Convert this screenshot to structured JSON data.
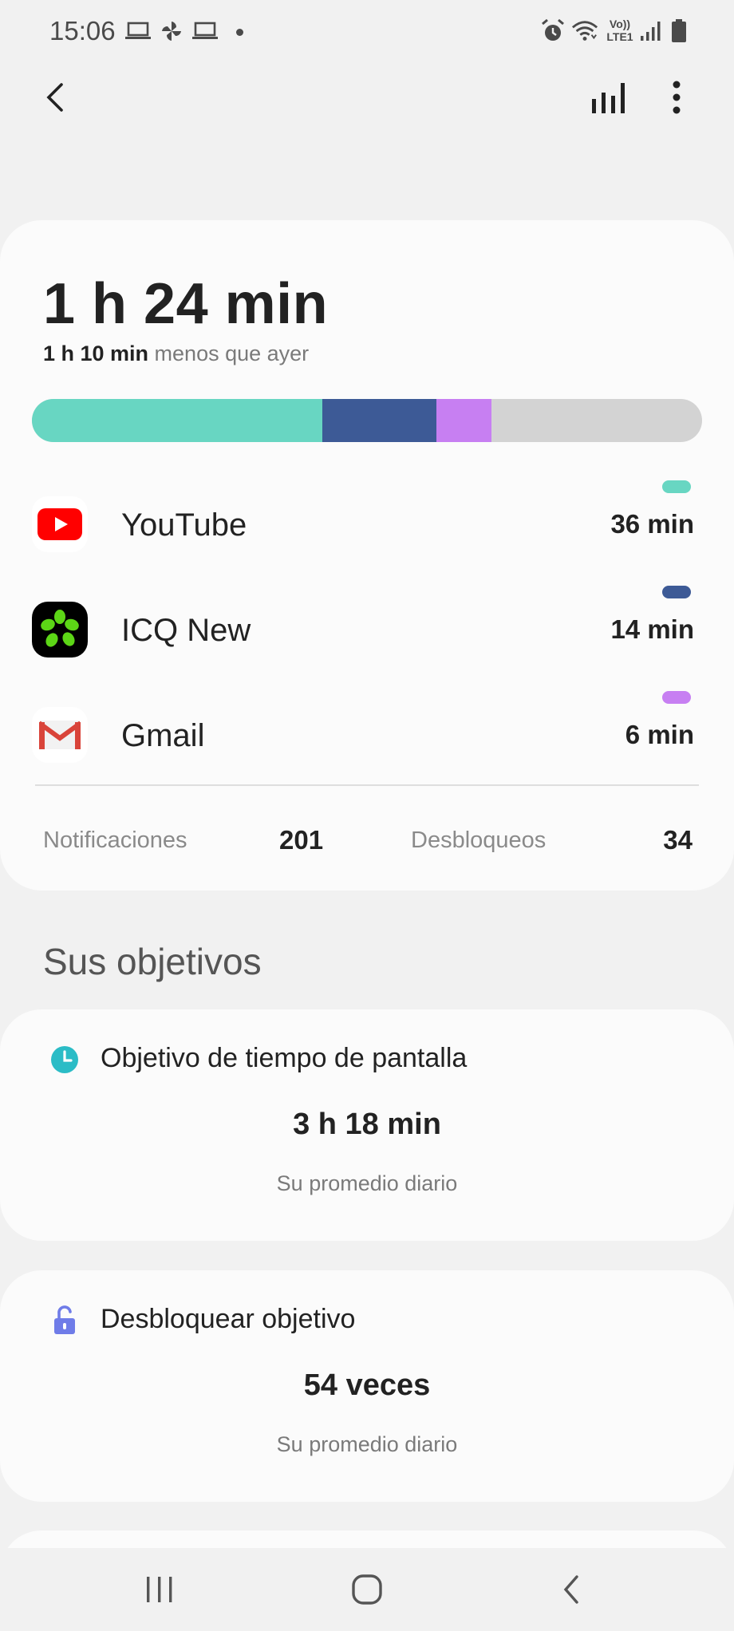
{
  "status_bar": {
    "time": "15:06",
    "right_icons": [
      "alarm-icon",
      "wifi-icon",
      "volte-lte-icon",
      "signal-icon",
      "battery-icon"
    ],
    "volte_label": "Vo))",
    "lte_label": "LTE1"
  },
  "summary": {
    "total_time": "1 h 24 min",
    "compare_bold": "1 h 10 min",
    "compare_rest": " menos que ayer",
    "usage_bar": [
      {
        "app": "YouTube",
        "fraction": 0.433,
        "color": "#68d6c2"
      },
      {
        "app": "ICQ New",
        "fraction": 0.171,
        "color": "#3d5a96"
      },
      {
        "app": "Gmail",
        "fraction": 0.082,
        "color": "#c77ff2"
      }
    ],
    "apps": [
      {
        "name": "YouTube",
        "time": "36 min",
        "color": "#68d6c2",
        "icon": "youtube-icon"
      },
      {
        "name": "ICQ New",
        "time": "14 min",
        "color": "#3d5a96",
        "icon": "icq-icon"
      },
      {
        "name": "Gmail",
        "time": "6 min",
        "color": "#c77ff2",
        "icon": "gmail-icon"
      }
    ],
    "notifications_label": "Notificaciones",
    "notifications_value": "201",
    "unlocks_label": "Desbloqueos",
    "unlocks_value": "34"
  },
  "goals": {
    "section_title": "Sus objetivos",
    "screen_time": {
      "title": "Objetivo de tiempo de pantalla",
      "value": "3 h 18 min",
      "sub": "Su promedio diario"
    },
    "unlock": {
      "title": "Desbloquear objetivo",
      "value": "54 veces",
      "sub": "Su promedio diario"
    }
  },
  "colors": {
    "background": "#f1f1f1",
    "card": "#fbfbfb",
    "clock_icon": "#2bbcc6",
    "lock_icon": "#6f7ce8"
  }
}
